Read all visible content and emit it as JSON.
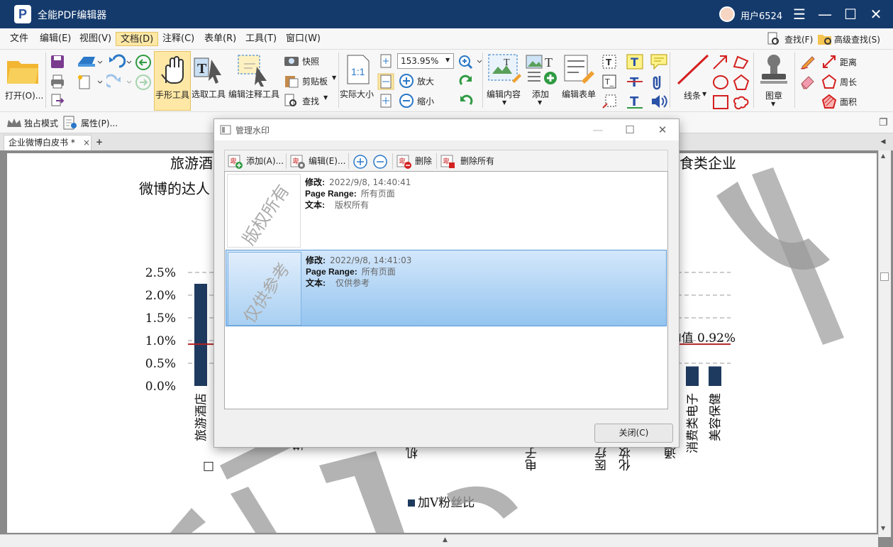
{
  "app": {
    "logo": "P",
    "title": "全能PDF编辑器",
    "user": "用户6524"
  },
  "window_buttons": {
    "menu": "☰",
    "minimize": "—",
    "maximize": "☐",
    "close": "✕"
  },
  "menu": {
    "items": [
      "文件",
      "编辑(E)",
      "视图(V)",
      "文档(D)",
      "注释(C)",
      "表单(R)",
      "工具(T)",
      "窗口(W)"
    ],
    "find": "查找(F)",
    "advanced_find": "高级查找(S)"
  },
  "ribbon": {
    "open": "打开(O)...",
    "hand_tool": "手形工具",
    "select_tool": "选取工具",
    "edit_annot_tool": "编辑注释工具",
    "snapshot": "快照",
    "clipboard": "剪贴板",
    "find": "查找",
    "actual_size": "实际大小",
    "zoom_value": "153.95%",
    "zoom_in": "放大",
    "zoom_out": "缩小",
    "edit_content": "编辑内容",
    "add": "添加",
    "edit_form": "编辑表单",
    "lines": "线条",
    "stamp": "图章",
    "distance": "距离",
    "perimeter": "周长",
    "area": "面积"
  },
  "toolbar2": {
    "exclusive_mode": "独占模式",
    "properties": "属性(P)..."
  },
  "tabs": {
    "doc_tab": "企业微博白皮书 *",
    "close": "×",
    "add": "+"
  },
  "document": {
    "title_line1_left": "旅游酒",
    "title_line1_right": "食类企业",
    "title_line2_left": "微博的达人",
    "legend": "加V粉丝比",
    "avg_label": "均值 0.92%",
    "watermark_text": "版权所有",
    "categories_visible": [
      "旅游酒店",
      "消费类电子",
      "美容保健"
    ],
    "partial_labels": [
      "媒",
      "机",
      "电子",
      "医疗",
      "化妆",
      "通"
    ]
  },
  "chart_data": {
    "type": "bar",
    "ylim": [
      0,
      2.5
    ],
    "yticks": [
      "0.0%",
      "0.5%",
      "1.0%",
      "1.5%",
      "2.0%",
      "2.5%"
    ],
    "categories": [
      "旅游酒店",
      "消费类电子",
      "美容保健"
    ],
    "values": [
      2.25,
      0.43,
      0.43
    ],
    "average": 0.92,
    "legend": "加V粉丝比",
    "bar_color": "#1f3a5f",
    "avg_color": "#b22222"
  },
  "dialog": {
    "title": "管理水印",
    "toolbar": {
      "add": "添加(A)...",
      "edit": "编辑(E)...",
      "delete": "删除",
      "delete_all": "删除所有"
    },
    "items": [
      {
        "thumb": "版权所有",
        "modified_label": "修改:",
        "modified": "2022/9/8, 14:40:41",
        "range_label": "Page Range:",
        "range": "所有页面",
        "text_label": "文本:",
        "text": "版权所有"
      },
      {
        "thumb": "仅供参考",
        "modified_label": "修改:",
        "modified": "2022/9/8, 14:41:03",
        "range_label": "Page Range:",
        "range": "所有页面",
        "text_label": "文本:",
        "text": "仅供参考"
      }
    ],
    "close": "关闭(C)"
  }
}
